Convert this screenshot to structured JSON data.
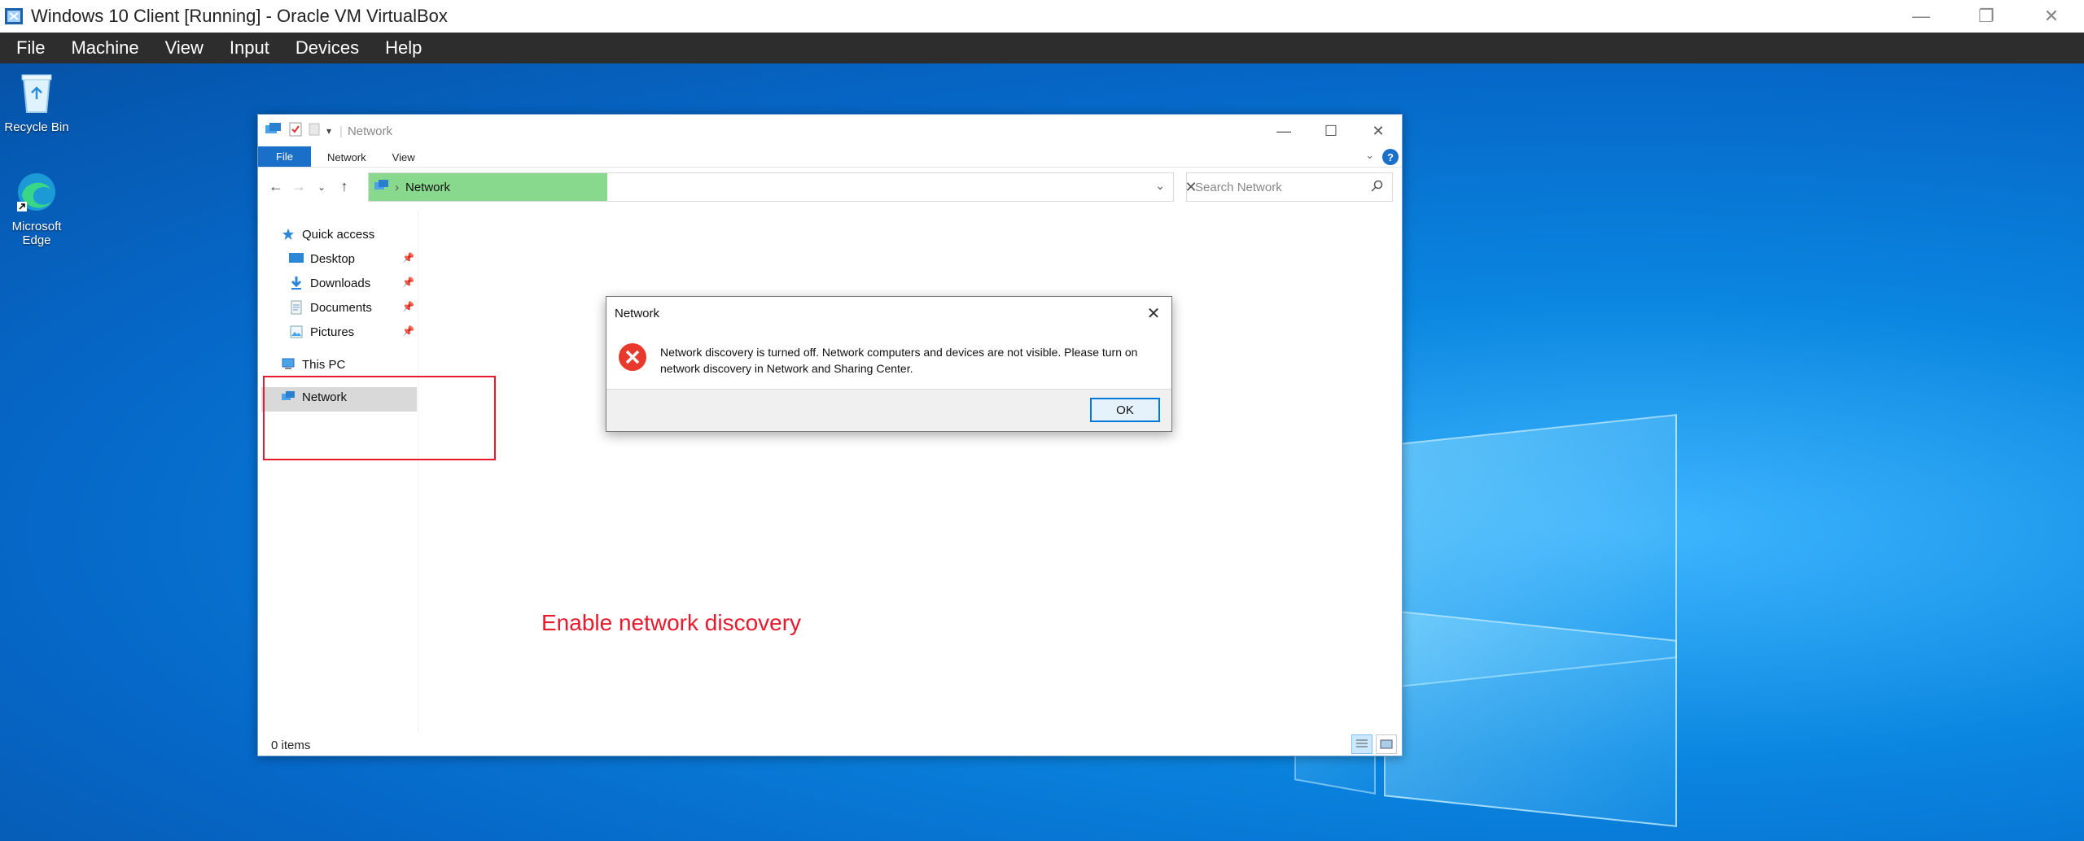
{
  "host": {
    "title": "Windows 10 Client [Running] - Oracle VM VirtualBox",
    "menu": [
      "File",
      "Machine",
      "View",
      "Input",
      "Devices",
      "Help"
    ]
  },
  "desktop": {
    "icons": [
      {
        "label": "Recycle Bin",
        "icon": "recycle-bin-icon"
      },
      {
        "label": "Microsoft Edge",
        "icon": "edge-icon"
      }
    ]
  },
  "explorer": {
    "title": "Network",
    "ribbon_tabs": [
      "File",
      "Network",
      "View"
    ],
    "help_label": "?",
    "address": {
      "location": "Network"
    },
    "search": {
      "placeholder": "Search Network"
    },
    "nav": {
      "quick_access": "Quick access",
      "desktop": "Desktop",
      "downloads": "Downloads",
      "documents": "Documents",
      "pictures": "Pictures",
      "this_pc": "This PC",
      "network": "Network"
    },
    "status": "0 items"
  },
  "dialog": {
    "title": "Network",
    "message": "Network discovery is turned off. Network computers and devices are not visible. Please turn on network discovery in Network and Sharing Center.",
    "ok_label": "OK"
  },
  "annotation": {
    "text": "Enable network discovery",
    "color": "#e8192c"
  },
  "colors": {
    "address_highlight": "#88d88d",
    "ribbon_file": "#1a6fc9",
    "menubar": "#2d2d2d"
  }
}
